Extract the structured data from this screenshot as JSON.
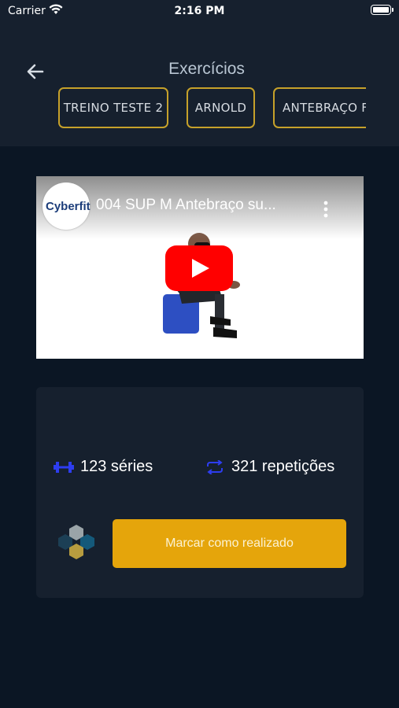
{
  "status_bar": {
    "carrier": "Carrier",
    "time": "2:16 PM"
  },
  "header": {
    "title": "Exercícios",
    "chips": [
      "TREINO TESTE 2",
      "ARNOLD",
      "ANTEBRAÇO F"
    ]
  },
  "video": {
    "channel_logo": "Cyberfit",
    "title": "004 SUP M Antebraço su..."
  },
  "card": {
    "series": "123 séries",
    "reps": "321 repetições",
    "done_button": "Marcar como realizado"
  },
  "colors": {
    "background": "#0b1624",
    "header": "#16202e",
    "accent": "#e5a50b",
    "chip_border": "#c6a12a",
    "icon_blue": "#2d3df0"
  }
}
